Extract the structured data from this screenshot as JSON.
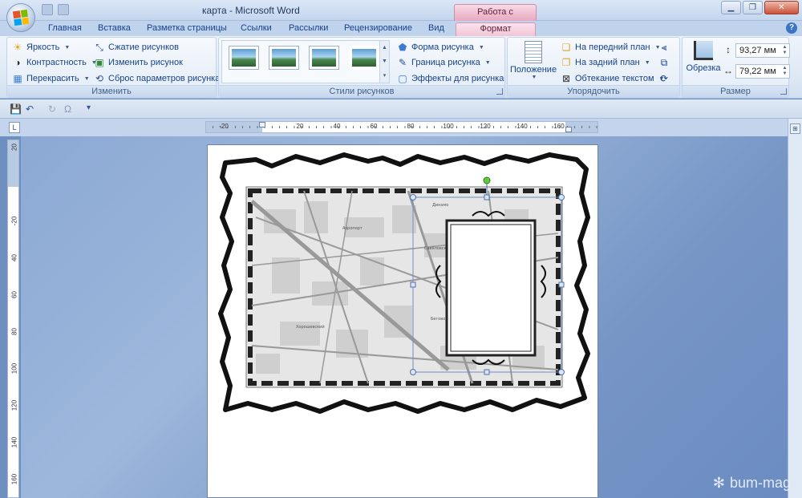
{
  "titlebar": {
    "doc_title": "карта - Microsoft Word",
    "context_tab_group": "Работа с рисунками",
    "min_label": "▁",
    "restore_label": "❐",
    "close_label": "✕"
  },
  "tabs": {
    "home": "Главная",
    "insert": "Вставка",
    "layout": "Разметка страницы",
    "refs": "Ссылки",
    "mailings": "Рассылки",
    "review": "Рецензирование",
    "view": "Вид",
    "format": "Формат",
    "help": "?"
  },
  "ribbon": {
    "adjust": {
      "label": "Изменить",
      "brightness": "Яркость",
      "contrast": "Контрастность",
      "recolor": "Перекрасить",
      "compress": "Сжатие рисунков",
      "change": "Изменить рисунок",
      "reset": "Сброс параметров рисунка"
    },
    "styles": {
      "label": "Стили рисунков",
      "shape": "Форма рисунка",
      "border": "Граница рисунка",
      "effects": "Эффекты для рисунка"
    },
    "arrange": {
      "label": "Упорядочить",
      "position": "Положение",
      "front": "На передний план",
      "back": "На задний план",
      "wrap": "Обтекание текстом"
    },
    "size": {
      "label": "Размер",
      "crop": "Обрезка",
      "height": "93,27 мм",
      "width": "79,22 мм"
    }
  },
  "qat": {
    "save": "💾",
    "undo": "↶",
    "redo": "↻",
    "symbol": "Ω",
    "customize": "▾"
  },
  "ruler": {
    "h_numbers": [
      "-20",
      "-20",
      "20",
      "40",
      "60",
      "80",
      "100",
      "120",
      "140",
      "160"
    ],
    "v_numbers": [
      "20",
      "-20",
      "40",
      "60",
      "80",
      "100",
      "120",
      "140",
      "160"
    ],
    "corner": "L"
  },
  "watermark": {
    "text": "bum-mag",
    "icon": "snowflake-icon"
  },
  "map_labels": [
    "Аэропорт",
    "Савёловский",
    "Хорошевский",
    "Беговой",
    "Динамо"
  ]
}
